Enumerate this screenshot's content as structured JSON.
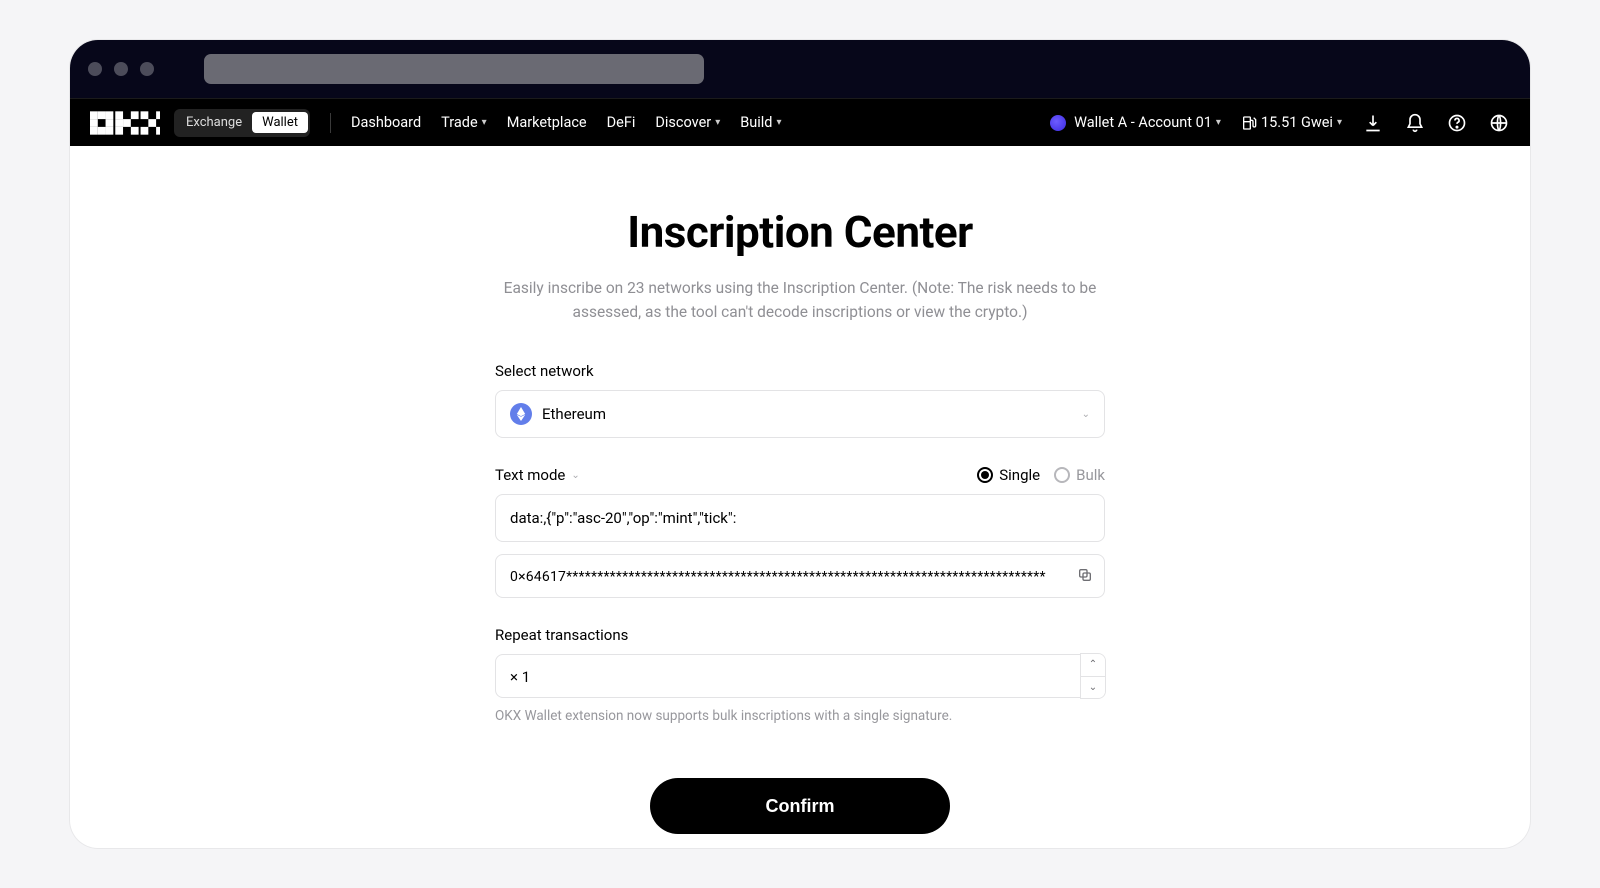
{
  "nav": {
    "segment": {
      "exchange": "Exchange",
      "wallet": "Wallet"
    },
    "items": {
      "dashboard": "Dashboard",
      "trade": "Trade",
      "marketplace": "Marketplace",
      "defi": "DeFi",
      "discover": "Discover",
      "build": "Build"
    },
    "wallet_label": "Wallet A - Account 01",
    "gas_label": "15.51 Gwei"
  },
  "page": {
    "title": "Inscription Center",
    "subtitle": "Easily inscribe on 23 networks using the Inscription Center. (Note: The risk needs to be assessed, as the tool can't decode inscriptions or view the crypto.)"
  },
  "form": {
    "select_network_label": "Select network",
    "network_selected": "Ethereum",
    "mode_label": "Text mode",
    "single_label": "Single",
    "bulk_label": "Bulk",
    "text_value": "data:,{\"p\":\"asc-20\",\"op\":\"mint\",\"tick\":",
    "hex_value": "0×64617*****************************************************************************",
    "repeat_label": "Repeat transactions",
    "repeat_value": "× 1",
    "hint": "OKX Wallet extension now supports bulk inscriptions with a single signature.",
    "confirm": "Confirm"
  }
}
